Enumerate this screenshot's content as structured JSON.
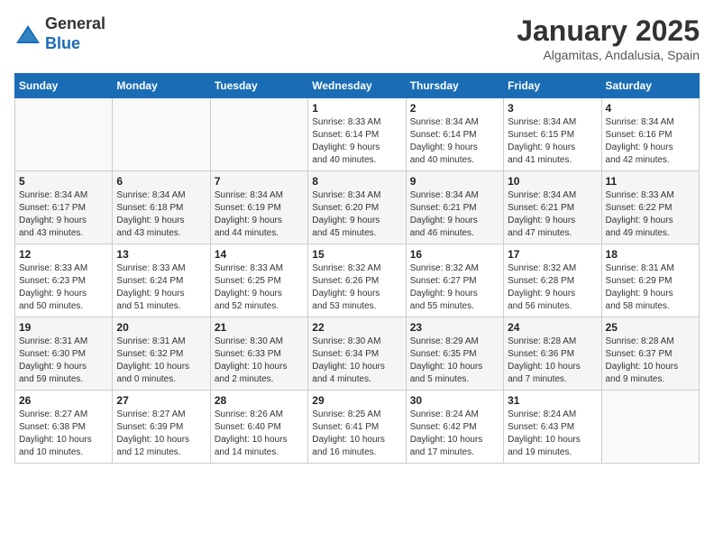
{
  "logo": {
    "general": "General",
    "blue": "Blue"
  },
  "header": {
    "month_year": "January 2025",
    "location": "Algamitas, Andalusia, Spain"
  },
  "weekdays": [
    "Sunday",
    "Monday",
    "Tuesday",
    "Wednesday",
    "Thursday",
    "Friday",
    "Saturday"
  ],
  "weeks": [
    [
      {
        "day": "",
        "info": ""
      },
      {
        "day": "",
        "info": ""
      },
      {
        "day": "",
        "info": ""
      },
      {
        "day": "1",
        "info": "Sunrise: 8:33 AM\nSunset: 6:14 PM\nDaylight: 9 hours\nand 40 minutes."
      },
      {
        "day": "2",
        "info": "Sunrise: 8:34 AM\nSunset: 6:14 PM\nDaylight: 9 hours\nand 40 minutes."
      },
      {
        "day": "3",
        "info": "Sunrise: 8:34 AM\nSunset: 6:15 PM\nDaylight: 9 hours\nand 41 minutes."
      },
      {
        "day": "4",
        "info": "Sunrise: 8:34 AM\nSunset: 6:16 PM\nDaylight: 9 hours\nand 42 minutes."
      }
    ],
    [
      {
        "day": "5",
        "info": "Sunrise: 8:34 AM\nSunset: 6:17 PM\nDaylight: 9 hours\nand 43 minutes."
      },
      {
        "day": "6",
        "info": "Sunrise: 8:34 AM\nSunset: 6:18 PM\nDaylight: 9 hours\nand 43 minutes."
      },
      {
        "day": "7",
        "info": "Sunrise: 8:34 AM\nSunset: 6:19 PM\nDaylight: 9 hours\nand 44 minutes."
      },
      {
        "day": "8",
        "info": "Sunrise: 8:34 AM\nSunset: 6:20 PM\nDaylight: 9 hours\nand 45 minutes."
      },
      {
        "day": "9",
        "info": "Sunrise: 8:34 AM\nSunset: 6:21 PM\nDaylight: 9 hours\nand 46 minutes."
      },
      {
        "day": "10",
        "info": "Sunrise: 8:34 AM\nSunset: 6:21 PM\nDaylight: 9 hours\nand 47 minutes."
      },
      {
        "day": "11",
        "info": "Sunrise: 8:33 AM\nSunset: 6:22 PM\nDaylight: 9 hours\nand 49 minutes."
      }
    ],
    [
      {
        "day": "12",
        "info": "Sunrise: 8:33 AM\nSunset: 6:23 PM\nDaylight: 9 hours\nand 50 minutes."
      },
      {
        "day": "13",
        "info": "Sunrise: 8:33 AM\nSunset: 6:24 PM\nDaylight: 9 hours\nand 51 minutes."
      },
      {
        "day": "14",
        "info": "Sunrise: 8:33 AM\nSunset: 6:25 PM\nDaylight: 9 hours\nand 52 minutes."
      },
      {
        "day": "15",
        "info": "Sunrise: 8:32 AM\nSunset: 6:26 PM\nDaylight: 9 hours\nand 53 minutes."
      },
      {
        "day": "16",
        "info": "Sunrise: 8:32 AM\nSunset: 6:27 PM\nDaylight: 9 hours\nand 55 minutes."
      },
      {
        "day": "17",
        "info": "Sunrise: 8:32 AM\nSunset: 6:28 PM\nDaylight: 9 hours\nand 56 minutes."
      },
      {
        "day": "18",
        "info": "Sunrise: 8:31 AM\nSunset: 6:29 PM\nDaylight: 9 hours\nand 58 minutes."
      }
    ],
    [
      {
        "day": "19",
        "info": "Sunrise: 8:31 AM\nSunset: 6:30 PM\nDaylight: 9 hours\nand 59 minutes."
      },
      {
        "day": "20",
        "info": "Sunrise: 8:31 AM\nSunset: 6:32 PM\nDaylight: 10 hours\nand 0 minutes."
      },
      {
        "day": "21",
        "info": "Sunrise: 8:30 AM\nSunset: 6:33 PM\nDaylight: 10 hours\nand 2 minutes."
      },
      {
        "day": "22",
        "info": "Sunrise: 8:30 AM\nSunset: 6:34 PM\nDaylight: 10 hours\nand 4 minutes."
      },
      {
        "day": "23",
        "info": "Sunrise: 8:29 AM\nSunset: 6:35 PM\nDaylight: 10 hours\nand 5 minutes."
      },
      {
        "day": "24",
        "info": "Sunrise: 8:28 AM\nSunset: 6:36 PM\nDaylight: 10 hours\nand 7 minutes."
      },
      {
        "day": "25",
        "info": "Sunrise: 8:28 AM\nSunset: 6:37 PM\nDaylight: 10 hours\nand 9 minutes."
      }
    ],
    [
      {
        "day": "26",
        "info": "Sunrise: 8:27 AM\nSunset: 6:38 PM\nDaylight: 10 hours\nand 10 minutes."
      },
      {
        "day": "27",
        "info": "Sunrise: 8:27 AM\nSunset: 6:39 PM\nDaylight: 10 hours\nand 12 minutes."
      },
      {
        "day": "28",
        "info": "Sunrise: 8:26 AM\nSunset: 6:40 PM\nDaylight: 10 hours\nand 14 minutes."
      },
      {
        "day": "29",
        "info": "Sunrise: 8:25 AM\nSunset: 6:41 PM\nDaylight: 10 hours\nand 16 minutes."
      },
      {
        "day": "30",
        "info": "Sunrise: 8:24 AM\nSunset: 6:42 PM\nDaylight: 10 hours\nand 17 minutes."
      },
      {
        "day": "31",
        "info": "Sunrise: 8:24 AM\nSunset: 6:43 PM\nDaylight: 10 hours\nand 19 minutes."
      },
      {
        "day": "",
        "info": ""
      }
    ]
  ]
}
